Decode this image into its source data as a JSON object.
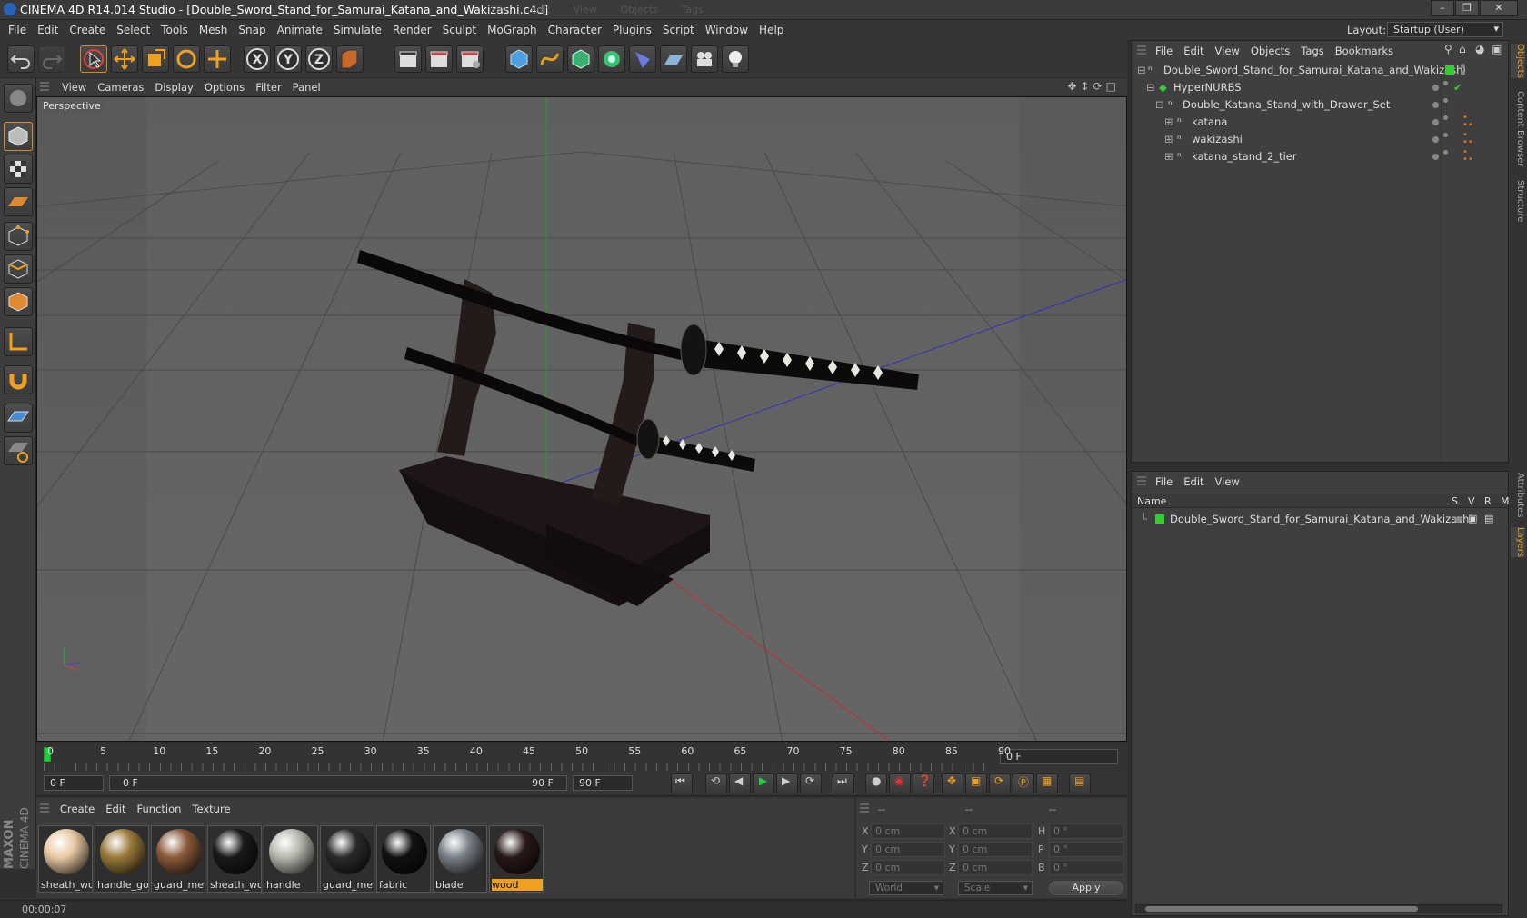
{
  "window": {
    "title": "CINEMA 4D R14.014 Studio - [Double_Sword_Stand_for_Samurai_Katana_and_Wakizashi.c4d]",
    "ghost_menu": [
      "File",
      "Edit",
      "View",
      "Objects",
      "Tags"
    ]
  },
  "menubar": [
    "File",
    "Edit",
    "Create",
    "Select",
    "Tools",
    "Mesh",
    "Snap",
    "Animate",
    "Simulate",
    "Render",
    "Sculpt",
    "MoGraph",
    "Character",
    "Plugins",
    "Script",
    "Window",
    "Help"
  ],
  "layout": {
    "label": "Layout:",
    "value": "Startup (User)"
  },
  "viewport": {
    "menu": [
      "View",
      "Cameras",
      "Display",
      "Options",
      "Filter",
      "Panel"
    ],
    "label": "Perspective"
  },
  "timeline": {
    "ticks": [
      "0",
      "5",
      "10",
      "15",
      "20",
      "25",
      "30",
      "35",
      "40",
      "45",
      "50",
      "55",
      "60",
      "65",
      "70",
      "75",
      "80",
      "85",
      "90"
    ],
    "end_field": "0 F",
    "current_field": "0 F",
    "range_start": "0 F",
    "range_end": "90 F",
    "max_field": "90 F"
  },
  "materials": {
    "menu": [
      "Create",
      "Edit",
      "Function",
      "Texture"
    ],
    "items": [
      {
        "name": "sheath_wo",
        "color": "#e8c9a2"
      },
      {
        "name": "handle_go",
        "color": "#9a7a3a"
      },
      {
        "name": "guard_met",
        "color": "#8a5a3a"
      },
      {
        "name": "sheath_wo",
        "color": "#1a1a1a"
      },
      {
        "name": "handle",
        "color": "#b8b8b0"
      },
      {
        "name": "guard_met",
        "color": "#2a2a2a"
      },
      {
        "name": "fabric",
        "color": "#111111"
      },
      {
        "name": "blade",
        "color": "#7a8088"
      },
      {
        "name": "wood",
        "color": "#2a1818",
        "selected": true
      }
    ]
  },
  "coords": {
    "headers": [
      "--",
      "--",
      "--"
    ],
    "rows": [
      {
        "a": "X",
        "av": "0 cm",
        "b": "X",
        "bv": "0 cm",
        "c": "H",
        "cv": "0 °"
      },
      {
        "a": "Y",
        "av": "0 cm",
        "b": "Y",
        "bv": "0 cm",
        "c": "P",
        "cv": "0 °"
      },
      {
        "a": "Z",
        "av": "0 cm",
        "b": "Z",
        "bv": "0 cm",
        "c": "B",
        "cv": "0 °"
      }
    ],
    "world": "World",
    "scale": "Scale",
    "apply": "Apply"
  },
  "status": {
    "time": "00:00:07"
  },
  "objects": {
    "menu": [
      "File",
      "Edit",
      "View",
      "Objects",
      "Tags",
      "Bookmarks"
    ],
    "tree": [
      {
        "label": "Double_Sword_Stand_for_Samurai_Katana_and_Wakizashi"
      },
      {
        "label": "HyperNURBS"
      },
      {
        "label": "Double_Katana_Stand_with_Drawer_Set"
      },
      {
        "label": "katana"
      },
      {
        "label": "wakizashi"
      },
      {
        "label": "katana_stand_2_tier"
      }
    ]
  },
  "layers": {
    "menu": [
      "File",
      "Edit",
      "View"
    ],
    "columns": [
      "Name",
      "S",
      "V",
      "R",
      "M"
    ],
    "rows": [
      {
        "label": "Double_Sword_Stand_for_Samurai_Katana_and_Wakizashi"
      }
    ]
  },
  "side_tabs": [
    "Objects",
    "Content Browser",
    "Structure",
    "Attributes",
    "Layers"
  ],
  "brand": [
    "MAXON",
    "CINEMA 4D"
  ]
}
